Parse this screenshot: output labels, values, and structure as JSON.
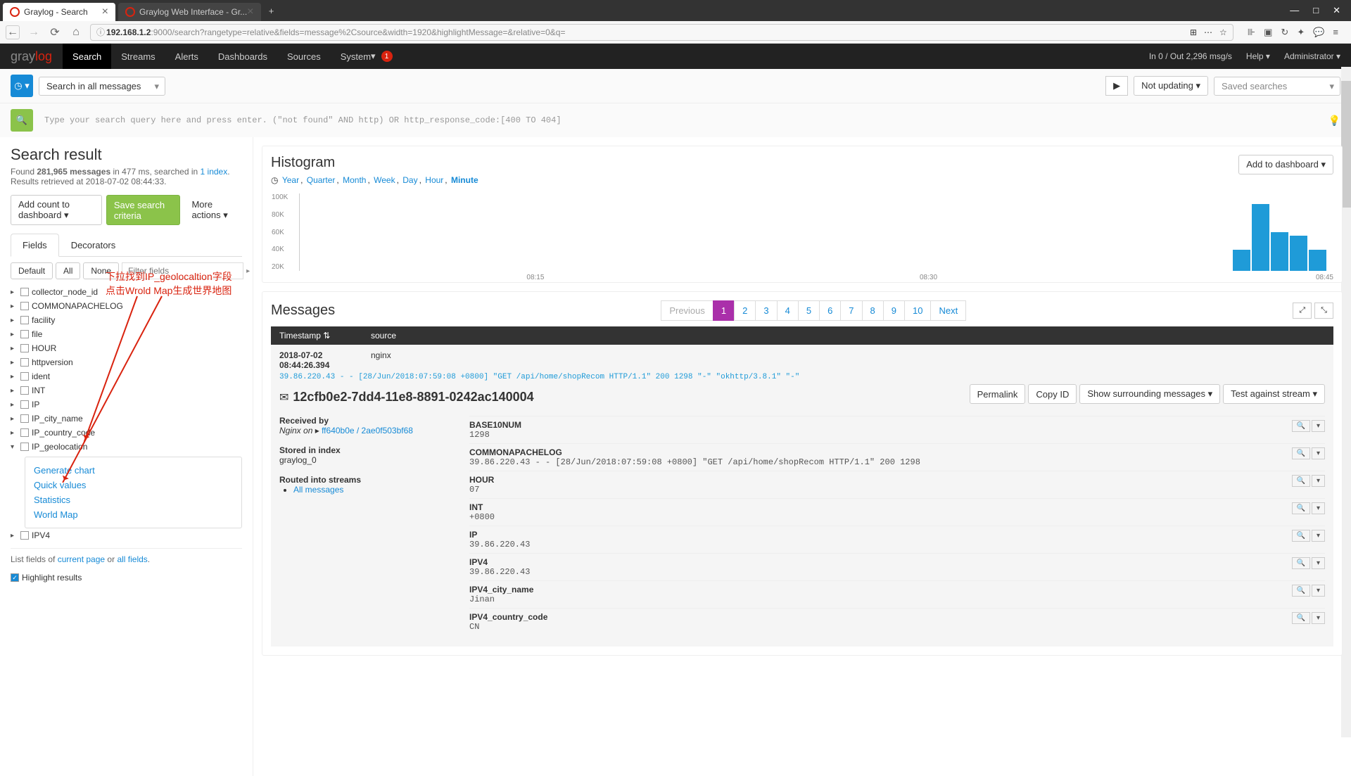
{
  "browser": {
    "tab1": "Graylog - Search",
    "tab2": "Graylog Web Interface - Gr...",
    "url_prefix": "ⓘ",
    "url_host": "192.168.1.2",
    "url_path": ":9000/search?rangetype=relative&fields=message%2Csource&width=1920&highlightMessage=&relative=0&q="
  },
  "nav": {
    "logo_gray": "gray",
    "logo_log": "log",
    "items": [
      "Search",
      "Streams",
      "Alerts",
      "Dashboards",
      "Sources",
      "System"
    ],
    "system_caret": "▾",
    "badge": "1",
    "in_out": "In 0 / Out 2,296 msg/s",
    "help": "Help ▾",
    "admin": "Administrator ▾"
  },
  "searchbar": {
    "clock": "◷ ▾",
    "range": "Search in all messages",
    "update": "Not updating ▾",
    "saved": "Saved searches"
  },
  "query": {
    "placeholder": "Type your search query here and press enter. (\"not found\" AND http) OR http_response_code:[400 TO 404]"
  },
  "sidebar": {
    "title": "Search result",
    "found_pre": "Found ",
    "found_bold": "281,965 messages",
    "found_mid": " in 477 ms, searched in ",
    "found_link": "1 index",
    "retrieved": "Results retrieved at 2018-07-02 08:44:33.",
    "add_count": "Add count to dashboard ▾",
    "save_criteria": "Save search criteria",
    "more_actions": "More actions ▾",
    "tab_fields": "Fields",
    "tab_decorators": "Decorators",
    "pill_default": "Default",
    "pill_all": "All",
    "pill_none": "None",
    "filter_placeholder": "Filter fields",
    "fields": [
      "collector_node_id",
      "COMMONAPACHELOG",
      "facility",
      "file",
      "HOUR",
      "httpversion",
      "ident",
      "INT",
      "IP",
      "IP_city_name",
      "IP_country_code",
      "IP_geolocation",
      "IPV4"
    ],
    "submenu": {
      "generate": "Generate chart",
      "quick": "Quick values",
      "stats": "Statistics",
      "world": "World Map"
    },
    "footer_pre": "List fields of ",
    "footer_current": "current page",
    "footer_or": " or ",
    "footer_all": "all fields",
    "highlight": "Highlight results",
    "annotation1": "下拉找到IP_geolocaltion字段",
    "annotation2": "点击Wrold Map生成世界地图"
  },
  "histogram": {
    "title": "Histogram",
    "add_dash": "Add to dashboard ▾",
    "timescales": [
      "Year",
      "Quarter",
      "Month",
      "Week",
      "Day",
      "Hour",
      "Minute"
    ],
    "y": [
      "20K",
      "40K",
      "60K",
      "80K",
      "100K"
    ],
    "x": [
      "08:15",
      "08:30",
      "08:45"
    ]
  },
  "chart_data": {
    "type": "bar",
    "title": "Histogram",
    "ylabel": "",
    "xlabel": "",
    "ylim": [
      0,
      100000
    ],
    "x_ticks": [
      "08:15",
      "08:30",
      "08:45"
    ],
    "categories": [
      "~08:42",
      "~08:43",
      "~08:44",
      "~08:45",
      "~08:46"
    ],
    "values": [
      30000,
      95000,
      55000,
      50000,
      30000
    ],
    "note": "Only 5 bars visible at far right; values estimated from gridlines"
  },
  "messages": {
    "title": "Messages",
    "prev": "Previous",
    "next": "Next",
    "pages": [
      "1",
      "2",
      "3",
      "4",
      "5",
      "6",
      "7",
      "8",
      "9",
      "10"
    ],
    "col_ts": "Timestamp ⇅",
    "col_src": "source",
    "row_ts": "2018-07-02 08:44:26.394",
    "row_src": "nginx",
    "row_log": "39.86.220.43 - - [28/Jun/2018:07:59:08 +0800] \"GET /api/home/shopRecom HTTP/1.1\" 200 1298 \"-\" \"okhttp/3.8.1\" \"-\"",
    "msg_id": "12cfb0e2-7dd4-11e8-8891-0242ac140004",
    "actions": {
      "permalink": "Permalink",
      "copyid": "Copy ID",
      "surround": "Show surrounding messages ▾",
      "test": "Test against stream ▾"
    },
    "left": {
      "received_by_label": "Received by",
      "received_by_pre": "Nginx on ",
      "received_by_link": "ff640b0e / 2ae0f503bf68",
      "stored_label": "Stored in index",
      "stored_val": "graylog_0",
      "routed_label": "Routed into streams",
      "routed_link": "All messages"
    },
    "fields": [
      {
        "name": "BASE10NUM",
        "val": "1298"
      },
      {
        "name": "COMMONAPACHELOG",
        "val": "39.86.220.43 - - [28/Jun/2018:07:59:08 +0800] \"GET /api/home/shopRecom HTTP/1.1\" 200 1298"
      },
      {
        "name": "HOUR",
        "val": "07"
      },
      {
        "name": "INT",
        "val": "+0800"
      },
      {
        "name": "IP",
        "val": "39.86.220.43"
      },
      {
        "name": "IPV4",
        "val": "39.86.220.43"
      },
      {
        "name": "IPV4_city_name",
        "val": "Jinan"
      },
      {
        "name": "IPV4_country_code",
        "val": "CN"
      }
    ]
  }
}
